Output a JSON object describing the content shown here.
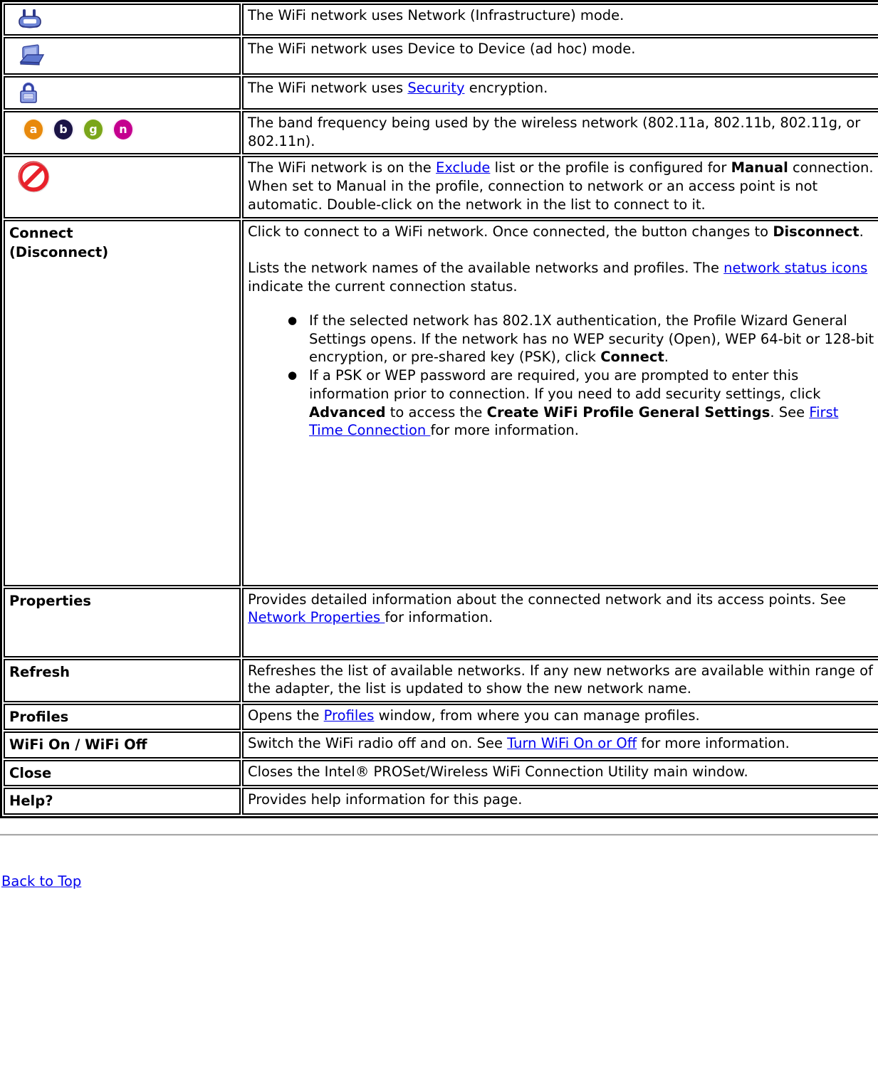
{
  "table": {
    "rows": [
      {
        "id": "infrastructure",
        "label_type": "icon",
        "icon": "wifi-router-icon",
        "desc_parts": [
          {
            "t": "text",
            "v": "The WiFi network uses Network (Infrastructure) mode."
          }
        ]
      },
      {
        "id": "adhoc",
        "label_type": "icon",
        "icon": "laptop-device-icon",
        "desc_parts": [
          {
            "t": "text",
            "v": "The WiFi network uses Device to Device (ad hoc) mode."
          }
        ]
      },
      {
        "id": "security",
        "label_type": "icon",
        "icon": "padlock-icon",
        "desc_parts": [
          {
            "t": "text",
            "v": "The WiFi network uses "
          },
          {
            "t": "link",
            "v": "Security"
          },
          {
            "t": "text",
            "v": " encryption."
          }
        ]
      },
      {
        "id": "band",
        "label_type": "band-icons",
        "bands": [
          {
            "letter": "a",
            "color": "#e8890c",
            "glow": "#f6d99a"
          },
          {
            "letter": "b",
            "color": "#1b1446",
            "glow": "#c9c6de"
          },
          {
            "letter": "g",
            "color": "#7aa61a",
            "glow": "#dcebb0"
          },
          {
            "letter": "n",
            "color": "#c4008f",
            "glow": "#f1b9e2"
          }
        ],
        "desc_parts": [
          {
            "t": "text",
            "v": "The band frequency being used by the wireless network (802.11a, 802.11b, 802.11g, or 802.11n)."
          }
        ]
      },
      {
        "id": "exclude",
        "label_type": "icon",
        "icon": "no-entry-icon",
        "desc_parts": [
          {
            "t": "text",
            "v": "The WiFi network is on the "
          },
          {
            "t": "link",
            "v": "Exclude"
          },
          {
            "t": "text",
            "v": " list or the profile is configured for "
          },
          {
            "t": "bold",
            "v": "Manual"
          },
          {
            "t": "text",
            "v": " connection. When set to Manual in the profile, connection to network or an access point is not automatic. Double-click on the network in the list to connect to it."
          }
        ]
      }
    ],
    "connect_row": {
      "label_line1": "Connect",
      "label_line2": "(Disconnect)",
      "para1": [
        {
          "t": "text",
          "v": "Click to connect to a WiFi network. Once connected, the button changes to "
        },
        {
          "t": "bold",
          "v": "Disconnect"
        },
        {
          "t": "text",
          "v": "."
        }
      ],
      "para2": [
        {
          "t": "text",
          "v": "Lists the network names of the available networks and profiles. The "
        },
        {
          "t": "link",
          "v": "network status icons"
        },
        {
          "t": "text",
          "v": " indicate the current connection status."
        }
      ],
      "bullets": [
        [
          {
            "t": "text",
            "v": "If the selected network has 802.1X authentication, the Profile Wizard General Settings opens. If the network has no WEP security (Open), WEP 64-bit or 128-bit encryption, or pre-shared key (PSK), click "
          },
          {
            "t": "bold",
            "v": "Connect"
          },
          {
            "t": "text",
            "v": "."
          }
        ],
        [
          {
            "t": "text",
            "v": "If a PSK or WEP password are required, you are prompted to enter this information prior to connection. If you need to add security settings, click "
          },
          {
            "t": "bold",
            "v": "Advanced"
          },
          {
            "t": "text",
            "v": " to access the "
          },
          {
            "t": "bold",
            "v": "Create WiFi Profile General Settings"
          },
          {
            "t": "text",
            "v": ". See "
          },
          {
            "t": "link",
            "v": "First Time Connection "
          },
          {
            "t": "text",
            "v": "for more information."
          }
        ]
      ]
    },
    "text_rows": [
      {
        "id": "properties",
        "label": "Properties",
        "tall": true,
        "desc_parts": [
          {
            "t": "text",
            "v": "Provides detailed information about the connected network and its access points. See "
          },
          {
            "t": "link",
            "v": "Network Properties "
          },
          {
            "t": "text",
            "v": "for information."
          }
        ]
      },
      {
        "id": "refresh",
        "label": "Refresh",
        "tall": false,
        "desc_parts": [
          {
            "t": "text",
            "v": "Refreshes the list of available networks. If any new networks are available within range of the adapter, the list is updated to show the new network name."
          }
        ]
      },
      {
        "id": "profiles",
        "label": "Profiles",
        "tall": false,
        "desc_parts": [
          {
            "t": "text",
            "v": "Opens the "
          },
          {
            "t": "link",
            "v": "Profiles"
          },
          {
            "t": "text",
            "v": " window, from where you can manage profiles."
          }
        ]
      },
      {
        "id": "wifi-on-off",
        "label": "WiFi On / WiFi Off",
        "tall": false,
        "desc_parts": [
          {
            "t": "text",
            "v": "Switch the WiFi radio off and on. See "
          },
          {
            "t": "link",
            "v": "Turn WiFi On or Off"
          },
          {
            "t": "text",
            "v": " for more information."
          }
        ]
      },
      {
        "id": "close",
        "label": "Close",
        "tall": false,
        "desc_parts": [
          {
            "t": "text",
            "v": "Closes the Intel® PROSet/Wireless WiFi Connection Utility main window."
          }
        ]
      },
      {
        "id": "help",
        "label": "Help?",
        "tall": false,
        "desc_parts": [
          {
            "t": "text",
            "v": "Provides help information for this page."
          }
        ]
      }
    ]
  },
  "footer": {
    "back_to_top": "Back to Top"
  },
  "colors": {
    "link": "#0000ee",
    "border": "#000000",
    "rule": "#a9a9a9"
  }
}
